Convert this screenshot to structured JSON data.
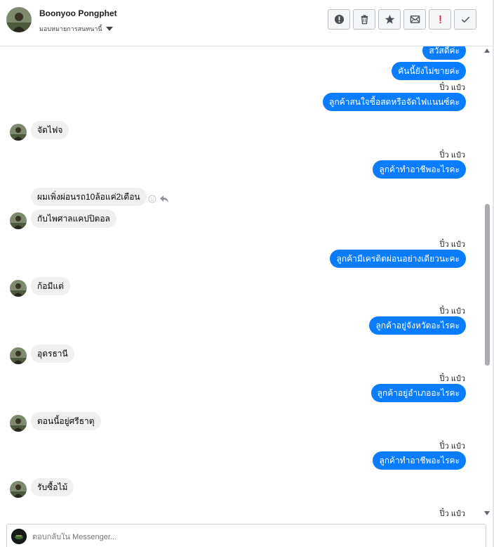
{
  "header": {
    "name": "Boonyoo Pongphet",
    "subtitle": "มอบหมายการสนทนานี้",
    "toolbar": [
      "info-icon",
      "trash-icon",
      "star-icon",
      "mail-icon",
      "alert-icon",
      "check-icon"
    ]
  },
  "messages": {
    "m1": "สวัสดีค่ะ",
    "m2": "คันนี้ยังไม่ขายค่ะ",
    "meta1": "ปิ๋ว แป๋ว",
    "m3": "ลูกค้าสนใจซื้อสดหรือจัดไฟแนนซ์คะ",
    "m4": "จัดไฟจ",
    "meta2": "ปิ๋ว แป๋ว",
    "m5": "ลูกค้าทำอาชีพอะไรคะ",
    "m6": "ผมเพิ่งผ่อนรถ10ล้อแค่2เดือน",
    "m7": "กับไพศาลแคปปิตอล",
    "meta3": "ปิ๋ว แป๋ว",
    "m8": "ลูกค้ามีเครดิตผ่อนอย่างเดียวนะคะ",
    "m9": "ก้อมีแต่",
    "meta4": "ปิ๋ว แป๋ว",
    "m10": "ลูกค้าอยู่จังหวัดอะไรคะ",
    "m11": "อุดรธานี",
    "meta5": "ปิ๋ว แป๋ว",
    "m12": "ลูกค้าอยู่อำเภออะไรคะ",
    "m13": "ตอนนี้อยู่ศรีธาตุ",
    "meta6": "ปิ๋ว แป๋ว",
    "m14": "ลูกค้าทำอาชีพอะไรคะ",
    "m15": "รับซื้อไม้",
    "meta7": "ปิ๋ว แป๋ว"
  },
  "composer": {
    "placeholder": "ตอบกลับใน Messenger..."
  },
  "colors": {
    "outgoing": "#0a7cff",
    "incoming": "#f0f0f0",
    "alert": "#e41e3f"
  }
}
